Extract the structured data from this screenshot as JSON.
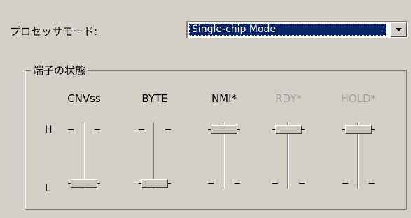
{
  "processor_mode": {
    "label": "プロセッサモード:",
    "selected": "Single-chip Mode"
  },
  "pins": {
    "group_title": "端子の状態",
    "high_label": "H",
    "low_label": "L",
    "items": [
      {
        "label": "CNVss",
        "state": "L",
        "enabled": true
      },
      {
        "label": "BYTE",
        "state": "L",
        "enabled": true
      },
      {
        "label": "NMI*",
        "state": "H",
        "enabled": true
      },
      {
        "label": "RDY*",
        "state": "H",
        "enabled": false
      },
      {
        "label": "HOLD*",
        "state": "H",
        "enabled": false
      }
    ]
  },
  "icons": {
    "dropdown": "chevron-down-icon"
  }
}
